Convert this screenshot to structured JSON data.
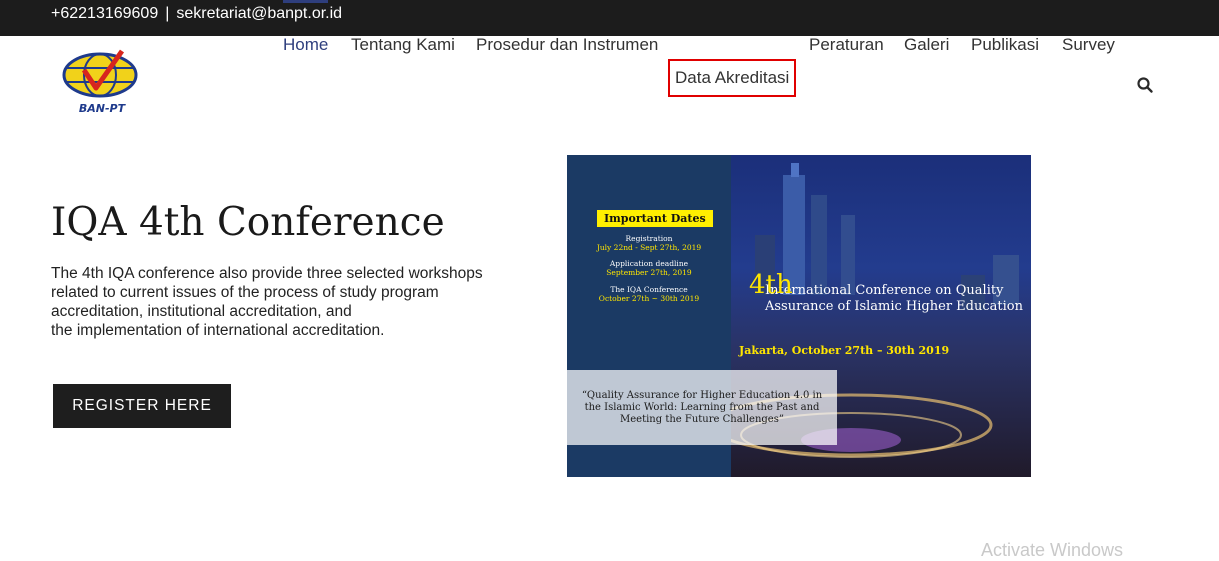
{
  "topbar": {
    "phone": "+62213169609",
    "separator": "|",
    "email": "sekretariat@banpt.or.id"
  },
  "logo": {
    "text": "BAN-PT"
  },
  "nav": {
    "items": [
      {
        "label": "Home",
        "active": true
      },
      {
        "label": "Tentang Kami"
      },
      {
        "label": "Prosedur dan Instrumen"
      },
      {
        "label": "Data Akreditasi",
        "highlighted": true
      },
      {
        "label": "Peraturan"
      },
      {
        "label": "Galeri"
      },
      {
        "label": "Publikasi"
      },
      {
        "label": "Survey"
      }
    ],
    "search_icon": "search-icon"
  },
  "hero": {
    "title": "IQA 4th Conference",
    "lines": [
      "The 4th IQA conference also provide three selected workshops",
      "related to current issues of the process of study program",
      "accreditation, institutional accreditation, and",
      "the implementation of international accreditation."
    ],
    "button": "REGISTER HERE"
  },
  "poster": {
    "important_label": "Important Dates",
    "dates": [
      {
        "heading": "Registration",
        "value": "July 22nd - Sept 27th, 2019"
      },
      {
        "heading": "Application deadline",
        "value": "September 27th, 2019"
      },
      {
        "heading": "The IQA Conference",
        "value": "October 27th ~ 30th 2019"
      }
    ],
    "title_number": "4th",
    "title": "International Conference on Quality Assurance of Islamic Higher Education",
    "date": "Jakarta, October 27th – 30th 2019",
    "quote": "“Quality Assurance for Higher Education 4.0 in the Islamic World: Learning from the Past and Meeting the Future Challenges”"
  },
  "watermark": "Activate Windows",
  "colors": {
    "topbar": "#1c1c1c",
    "nav_active": "#2e3e7d",
    "highlight": "#e00000",
    "poster_blue": "#1b3a64",
    "poster_yellow": "#ffe600"
  }
}
